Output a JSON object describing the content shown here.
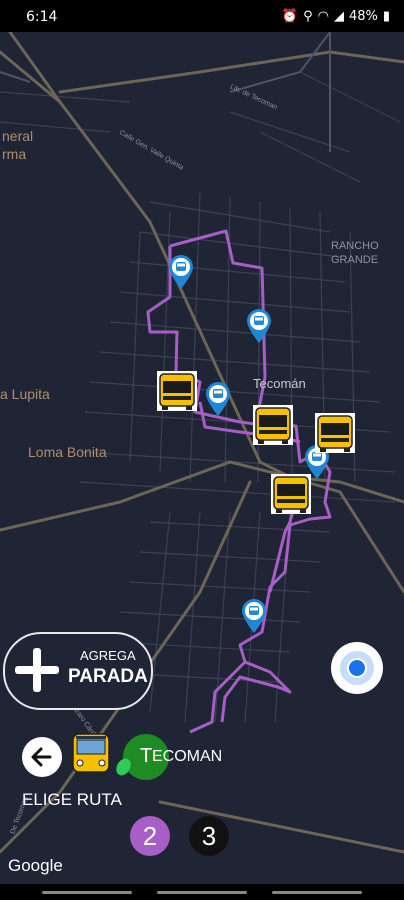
{
  "status": {
    "time": "6:14",
    "battery": "48%",
    "icons": [
      "alarm-icon",
      "location-icon",
      "wifi-icon",
      "signal-icon",
      "battery-icon"
    ]
  },
  "map": {
    "places": {
      "general": "neral",
      "general2": "rma",
      "lupita": "a Lupita",
      "loma_bonita": "Loma Bonita",
      "tecoman": "Tecomán",
      "rancho1": "RANCHO",
      "rancho2": "GRANDE"
    },
    "roads": {
      "lib": "Lib. de Tecoman",
      "calle_valle": "Calle Gen. Valle Quinta",
      "lazaro": "Lázaro Cárdenas",
      "tecoman_road": "De Tecoman"
    },
    "route_color": "#a75ec7",
    "pin_color": "#1e88d6",
    "bus_color": "#f5c000"
  },
  "controls": {
    "add_stop_line1": "AGREGA",
    "add_stop_line2": "PARADA",
    "route_letter": "T",
    "route_name": "ECOMAN",
    "choose_route": "ELIGE RUTA",
    "page_2": "2",
    "page_3": "3",
    "google": "Google"
  }
}
